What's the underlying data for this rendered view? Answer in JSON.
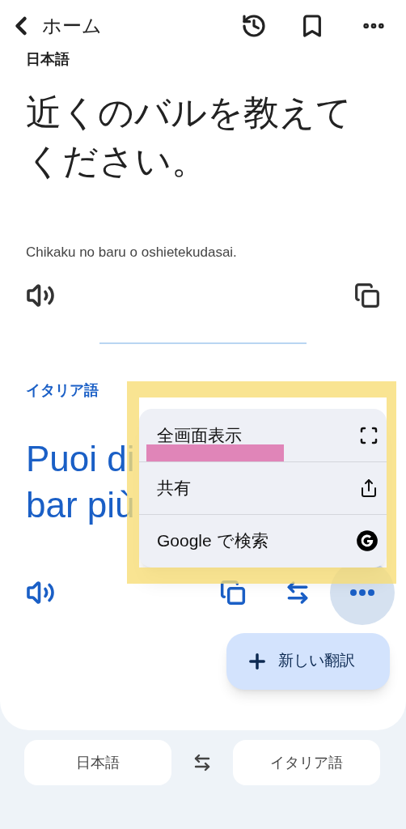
{
  "top_bar": {
    "back_label": "ホーム"
  },
  "source": {
    "language": "日本語",
    "text": "近くのバルを教えてください。",
    "romanization": "Chikaku no baru o oshietekudasai."
  },
  "target": {
    "language": "イタリア語",
    "lines": [
      "Puoi di",
      "bar più"
    ]
  },
  "menu": {
    "items": [
      {
        "label": "全画面表示",
        "kind": "fullscreen"
      },
      {
        "label": "共有",
        "kind": "share"
      },
      {
        "label": "Google で検索",
        "kind": "google"
      }
    ]
  },
  "new_translation": "新しい翻訳",
  "language_bar": {
    "from": "日本語",
    "to": "イタリア語"
  }
}
